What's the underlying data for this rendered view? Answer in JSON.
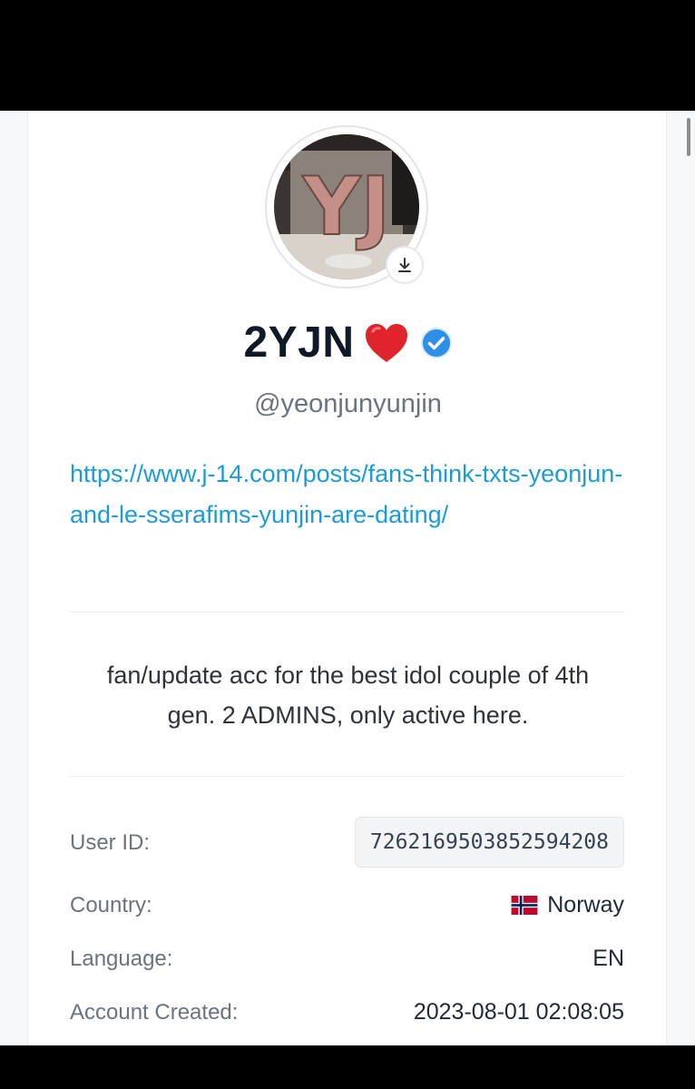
{
  "profile": {
    "display_name": "2YJN",
    "handle": "@yeonjunyunjin",
    "link": "https://www.j-14.com/posts/fans-think-txts-yeonjun-and-le-sserafims-yunjin-are-dating/",
    "bio": "fan/update acc for the best idol couple of 4th gen. 2 ADMINS, only active here.",
    "avatar_text": "YJ"
  },
  "details": {
    "user_id_label": "User ID:",
    "user_id": "7262169503852594208",
    "country_label": "Country:",
    "country": "Norway",
    "language_label": "Language:",
    "language": "EN",
    "created_label": "Account Created:",
    "created": "2023-08-01 02:08:05"
  },
  "icons": {
    "heart": "heart-icon",
    "verified": "verified-icon",
    "download": "download-icon",
    "flag": "norway-flag-icon"
  },
  "colors": {
    "link": "#1d9bd8",
    "verified": "#2f8ee5",
    "heart": "#e0242b"
  }
}
